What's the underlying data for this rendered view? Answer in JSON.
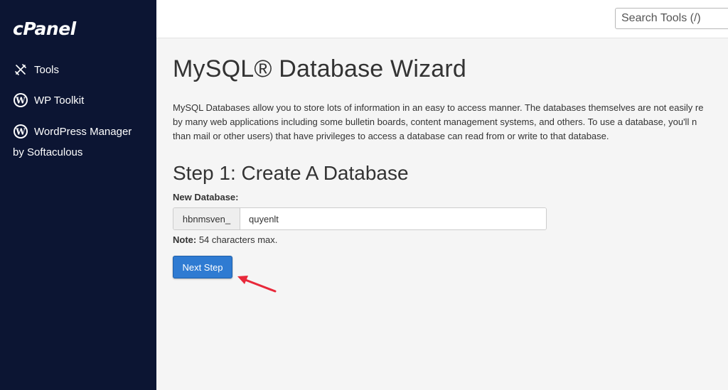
{
  "sidebar": {
    "logo": "cPanel",
    "items": [
      {
        "label": "Tools",
        "icon": "tools-icon"
      },
      {
        "label": "WP Toolkit",
        "icon": "wordpress-icon"
      },
      {
        "label": "WordPress Manager",
        "icon": "wordpress-icon"
      }
    ],
    "wpm_sub": "by Softaculous"
  },
  "topbar": {
    "search_placeholder": "Search Tools (/)"
  },
  "main": {
    "title": "MySQL® Database Wizard",
    "intro_lines": [
      "MySQL Databases allow you to store lots of information in an easy to access manner. The databases themselves are not easily re",
      "by many web applications including some bulletin boards, content management systems, and others. To use a database, you'll n",
      "than mail or other users) that have privileges to access a database can read from or write to that database."
    ],
    "step_title": "Step 1: Create A Database",
    "field_label": "New Database:",
    "prefix": "hbnmsven_",
    "db_value": "quyenlt",
    "note_label": "Note:",
    "note_text": " 54 characters max.",
    "next_label": "Next Step"
  },
  "colors": {
    "sidebar_bg": "#0c1533",
    "accent_button": "#2f7bd2",
    "arrow": "#e8283a"
  }
}
